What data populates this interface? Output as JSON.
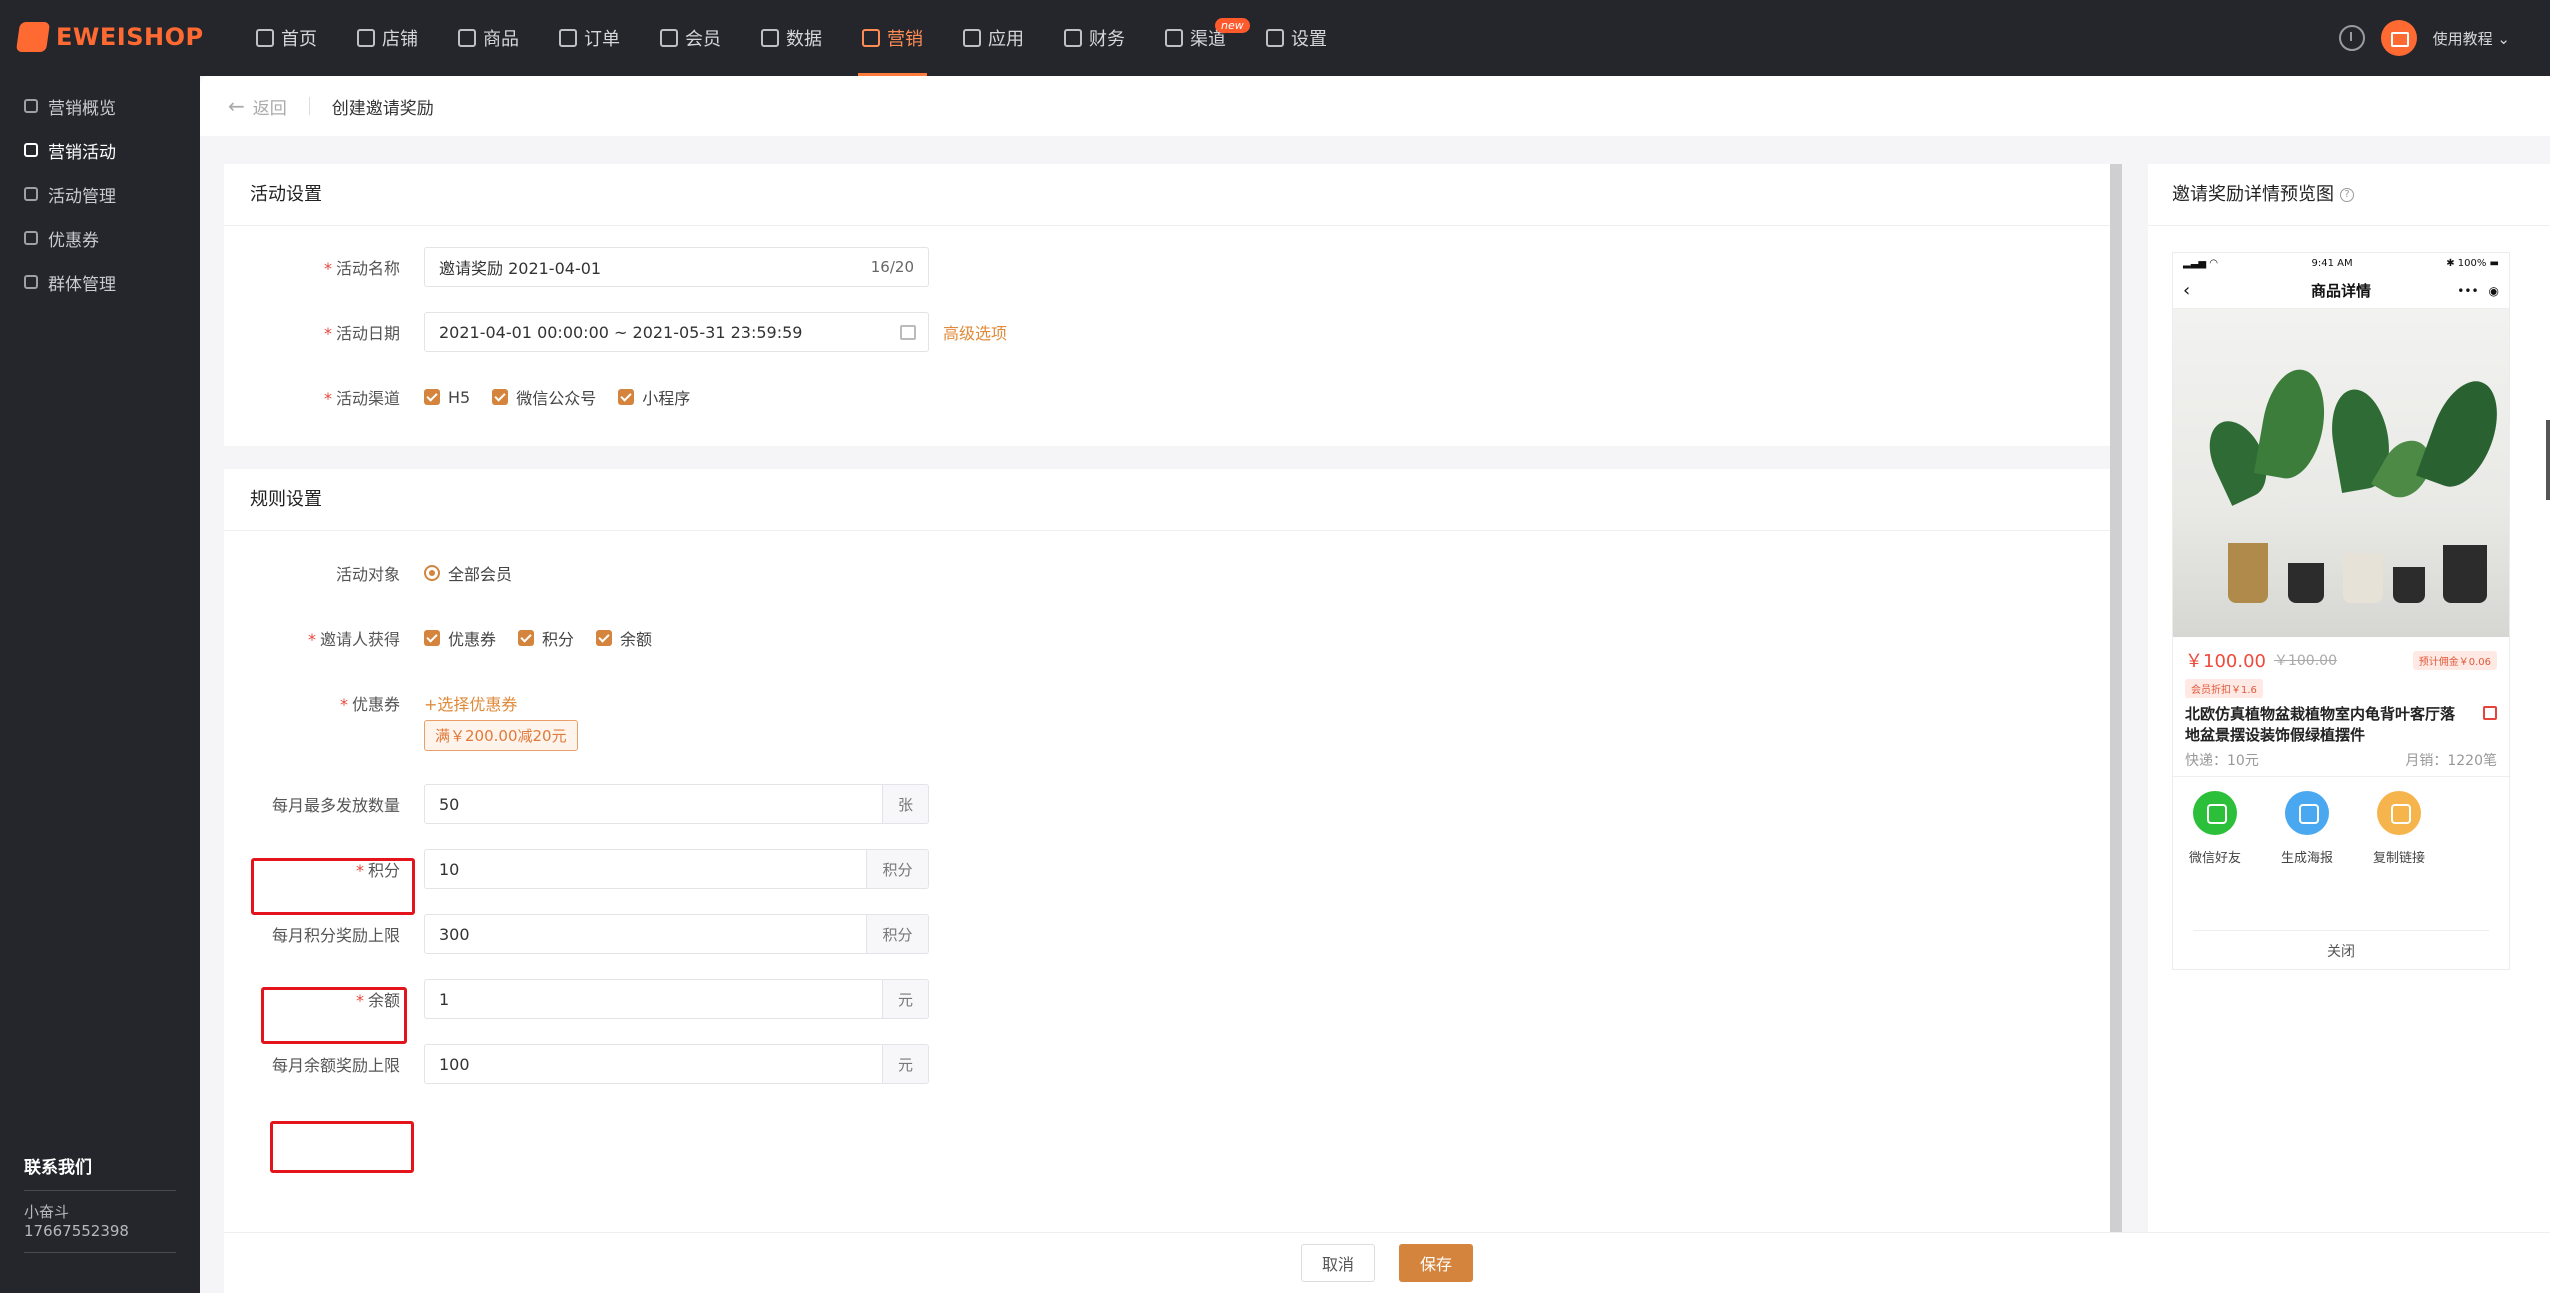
{
  "brand": "EWEISHOP",
  "nav": [
    {
      "label": "首页",
      "icon": "home-icon"
    },
    {
      "label": "店铺",
      "icon": "store-icon"
    },
    {
      "label": "商品",
      "icon": "goods-icon"
    },
    {
      "label": "订单",
      "icon": "order-icon"
    },
    {
      "label": "会员",
      "icon": "member-icon"
    },
    {
      "label": "数据",
      "icon": "chart-icon"
    },
    {
      "label": "营销",
      "icon": "tag-icon",
      "active": true
    },
    {
      "label": "应用",
      "icon": "apps-icon"
    },
    {
      "label": "财务",
      "icon": "finance-icon"
    },
    {
      "label": "渠道",
      "icon": "channel-icon",
      "badge": "new"
    },
    {
      "label": "设置",
      "icon": "gear-icon"
    }
  ],
  "topright": {
    "tutorial": "使用教程 ⌄"
  },
  "sidebar": {
    "items": [
      {
        "label": "营销概览"
      },
      {
        "label": "营销活动",
        "active": true
      },
      {
        "label": "活动管理"
      },
      {
        "label": "优惠券"
      },
      {
        "label": "群体管理"
      }
    ],
    "contact_title": "联系我们",
    "contact_name": "小奋斗",
    "contact_phone": "17667552398"
  },
  "breadcrumb": {
    "back": "返回",
    "current": "创建邀请奖励"
  },
  "activity": {
    "title": "活动设置",
    "name_label": "活动名称",
    "name_value": "邀请奖励  2021-04-01",
    "name_counter": "16/20",
    "date_label": "活动日期",
    "date_value": "2021-04-01 00:00:00 ~ 2021-05-31 23:59:59",
    "advanced": "高级选项",
    "channel_label": "活动渠道",
    "channels": [
      "H5",
      "微信公众号",
      "小程序"
    ]
  },
  "rules": {
    "title": "规则设置",
    "target_label": "活动对象",
    "target_value": "全部会员",
    "inviter_label": "邀请人获得",
    "inviter_options": [
      "优惠券",
      "积分",
      "余额"
    ],
    "coupon_label": "优惠券",
    "coupon_link": "+选择优惠券",
    "coupon_tag": "满￥200.00减20元",
    "monthly_coupon_label": "每月最多发放数量",
    "monthly_coupon_value": "50",
    "monthly_coupon_unit": "张",
    "points_label": "积分",
    "points_value": "10",
    "points_unit": "积分",
    "monthly_points_label": "每月积分奖励上限",
    "monthly_points_value": "300",
    "monthly_points_unit": "积分",
    "balance_label": "余额",
    "balance_value": "1",
    "balance_unit": "元",
    "monthly_balance_label": "每月余额奖励上限",
    "monthly_balance_value": "100",
    "monthly_balance_unit": "元"
  },
  "footer": {
    "cancel": "取消",
    "save": "保存"
  },
  "preview": {
    "title": "邀请奖励详情预览图",
    "status_time": "9:41 AM",
    "status_battery": "100%",
    "page_title": "商品详情",
    "price": "￥100.00",
    "old_price": "￥100.00",
    "commission": "预计佣金￥0.06",
    "member_price": "会员折扣￥1.6",
    "product_name": "北欧仿真植物盆栽植物室内龟背叶客厅落地盆景摆设装饰假绿植摆件",
    "shipping": "快递：10元",
    "monthly_sales": "月销：1220笔",
    "share": [
      {
        "label": "微信好友",
        "color": "#2cbf39"
      },
      {
        "label": "生成海报",
        "color": "#4aa8f0"
      },
      {
        "label": "复制链接",
        "color": "#f6b44c"
      }
    ],
    "close": "关闭"
  }
}
